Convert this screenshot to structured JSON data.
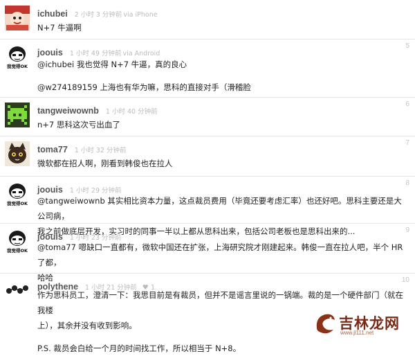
{
  "replies": [
    {
      "username": "ichubei",
      "time": "2 小时 3 分钟前",
      "via": "via iPhone",
      "number": "",
      "lines": [
        "N+7 牛逼啊"
      ]
    },
    {
      "username": "joouis",
      "time": "1 小时 49 分钟前",
      "via": "via Android",
      "number": "5",
      "avatar_caption": "我觉得OK",
      "lines": [
        "@ichubei 我也觉得 N+7 牛逼，真的良心",
        "@w274189159 上海也有华为嘛，思科的直接对手（滑稽脸"
      ]
    },
    {
      "username": "tangweiwownb",
      "time": "1 小时 40 分钟前",
      "number": "6",
      "lines": [
        "n+7 思科这次亏出血了"
      ]
    },
    {
      "username": "toma77",
      "time": "1 小时 32 分钟前",
      "number": "7",
      "lines": [
        "微软都在招人啊，刚看到韩俊也在拉人"
      ]
    },
    {
      "username": "joouis",
      "time": "1 小时 29 分钟前",
      "number": "8",
      "avatar_caption": "我觉得OK",
      "lines": [
        "@tangweiwownb 其实相比资本力量，这点裁员费用（毕竟还要考虑汇率）也还好吧。思科主要还是大公司病，",
        "我之前做底层开发，实习时的同事一半以上都从思科出来，包括公司老板也是思科出来的..."
      ]
    },
    {
      "username": "joouis",
      "time": "1 小时 23 分钟前",
      "number": "9",
      "avatar_caption": "我觉得OK",
      "lines": [
        "@toma77 嗯缺口一直都有，微软中国还在扩张，上海研究院才刚建起来。韩俊一直在拉人吧，半个 HR 了都，",
        "哈哈"
      ]
    },
    {
      "username": "polythene",
      "time": "1 小时 21 分钟前",
      "likes": "1",
      "number": "10",
      "lines": [
        "作为思科员工，澄清一下：我思目前是有裁员，但并不是谣言里说的一锅端。裁的是一个硬件部门（就在我楼",
        "上），其余并没有收到影响。",
        "P.S. 裁员会白给一个月的时间找工作，所以相当于 N+8。"
      ]
    }
  ],
  "watermark": {
    "text": "吉林龙网",
    "sub": "www.jl111.net"
  },
  "colors": {
    "username": "#555555",
    "meta": "#bbbbbb",
    "text": "#222222",
    "divider": "#e6e6e6"
  }
}
